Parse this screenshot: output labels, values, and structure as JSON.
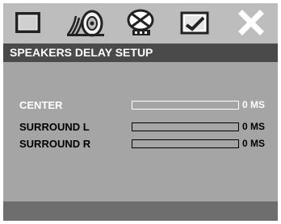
{
  "tabs": [
    {
      "id": "general",
      "icon": "monitor-icon"
    },
    {
      "id": "audio",
      "icon": "speaker-icon",
      "selected": true
    },
    {
      "id": "dolby",
      "icon": "dolby-icon"
    },
    {
      "id": "preference",
      "icon": "preference-icon"
    },
    {
      "id": "exit",
      "icon": "close-icon"
    }
  ],
  "header": {
    "title": "SPEAKERS DELAY SETUP"
  },
  "rows": [
    {
      "label": "CENTER",
      "value": "0 MS",
      "active": true,
      "level": 0
    },
    {
      "label": "SURROUND L",
      "value": "0 MS",
      "active": false,
      "level": 0
    },
    {
      "label": "SURROUND R",
      "value": "0 MS",
      "active": false,
      "level": 0
    }
  ],
  "colors": {
    "panel": "#a5a5a5",
    "iconbar": "#bdbdbd",
    "header": "#4a4a4a",
    "footer": "#6e6e6e",
    "active_text": "#ffffff",
    "text": "#000000"
  }
}
